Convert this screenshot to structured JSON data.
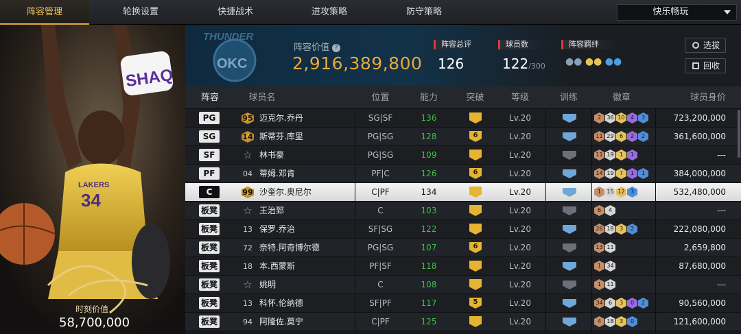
{
  "tabs": [
    "阵容管理",
    "轮换设置",
    "快捷战术",
    "进攻策略",
    "防守策略"
  ],
  "mode_select": {
    "value": "快乐畅玩"
  },
  "player_card": {
    "logo_text": "SHAQ",
    "jersey_number": "34",
    "team_text": "LAKERS",
    "market_value_label": "时刻价值",
    "market_value": "58,700,000"
  },
  "lineup_info": {
    "team_logo_text": "OKC",
    "team_logo_top_text": "THUNDER",
    "value_label": "阵容价值",
    "value": "2,916,389,800",
    "rating_label": "阵容总评",
    "rating": "126",
    "players_label": "球员数",
    "players": "122",
    "players_max": "/300",
    "chemistry_label": "阵容羁绊"
  },
  "buttons": {
    "scout": "选拔",
    "recycle": "回收"
  },
  "columns": [
    "阵容",
    "球员名",
    "位置",
    "能力",
    "突破",
    "等级",
    "训练",
    "徽章",
    "球员身价"
  ],
  "rows": [
    {
      "slot": "PG",
      "num": "95",
      "num_style": "gold",
      "name": "迈克尔.乔丹",
      "pos": "SG|SF",
      "ability": "136",
      "breakthrough": "",
      "level": "Lv.20",
      "train_color": "#6fa7d9",
      "badges": [
        [
          "2",
          "b-br"
        ],
        [
          "36",
          "b-si"
        ],
        [
          "10",
          "b-go"
        ],
        [
          "4",
          "b-pu"
        ],
        [
          "3",
          "b-bl"
        ]
      ],
      "value": "723,200,000"
    },
    {
      "slot": "SG",
      "num": "14",
      "num_style": "gold",
      "name": "斯蒂芬.库里",
      "pos": "PG|SG",
      "ability": "128",
      "breakthrough": "6",
      "level": "Lv.20",
      "train_color": "#6fa7d9",
      "badges": [
        [
          "11",
          "b-br"
        ],
        [
          "29",
          "b-si"
        ],
        [
          "6",
          "b-go"
        ],
        [
          "2",
          "b-pu"
        ],
        [
          "2",
          "b-bl"
        ]
      ],
      "value": "361,600,000"
    },
    {
      "slot": "SF",
      "num": "☆",
      "num_style": "star",
      "name": "林书豪",
      "pos": "PG|SG",
      "ability": "109",
      "breakthrough": "",
      "level": "Lv.20",
      "train_color": "#6c7078",
      "badges": [
        [
          "11",
          "b-br"
        ],
        [
          "19",
          "b-si"
        ],
        [
          "1",
          "b-go"
        ],
        [
          "1",
          "b-pu"
        ]
      ],
      "value": "---"
    },
    {
      "slot": "PF",
      "num": "04",
      "num_style": "",
      "name": "蒂姆.邓肯",
      "pos": "PF|C",
      "ability": "126",
      "breakthrough": "6",
      "level": "Lv.20",
      "train_color": "#6fa7d9",
      "badges": [
        [
          "14",
          "b-br"
        ],
        [
          "19",
          "b-si"
        ],
        [
          "7",
          "b-go"
        ],
        [
          "1",
          "b-pu"
        ],
        [
          "1",
          "b-bl"
        ]
      ],
      "value": "384,000,000"
    },
    {
      "slot": "C",
      "num": "99",
      "num_style": "gold",
      "name": "沙奎尔.奥尼尔",
      "pos": "C|PF",
      "ability": "134",
      "breakthrough": "",
      "level": "Lv.20",
      "train_color": "#6fa7d9",
      "badges": [
        [
          "1",
          "b-br"
        ],
        [
          "15",
          "b-si"
        ],
        [
          "12",
          "b-go"
        ],
        [
          "3",
          "b-bl"
        ]
      ],
      "value": "532,480,000",
      "selected": true
    },
    {
      "slot": "板凳",
      "num": "☆",
      "num_style": "star",
      "name": "王治郅",
      "pos": "C",
      "ability": "103",
      "breakthrough": "",
      "level": "Lv.20",
      "train_color": "#6c7078",
      "badges": [
        [
          "6",
          "b-br"
        ],
        [
          "4",
          "b-si"
        ]
      ],
      "value": "---"
    },
    {
      "slot": "板凳",
      "num": "13",
      "num_style": "",
      "name": "保罗.乔治",
      "pos": "SF|SG",
      "ability": "122",
      "breakthrough": "",
      "level": "Lv.20",
      "train_color": "#6fa7d9",
      "badges": [
        [
          "26",
          "b-br"
        ],
        [
          "18",
          "b-si"
        ],
        [
          "3",
          "b-go"
        ],
        [
          "2",
          "b-bl"
        ]
      ],
      "value": "222,080,000"
    },
    {
      "slot": "板凳",
      "num": "72",
      "num_style": "",
      "name": "奈特.阿奇博尔德",
      "pos": "PG|SG",
      "ability": "107",
      "breakthrough": "6",
      "level": "Lv.20",
      "train_color": "#6c7078",
      "badges": [
        [
          "13",
          "b-br"
        ],
        [
          "11",
          "b-si"
        ]
      ],
      "value": "2,659,800"
    },
    {
      "slot": "板凳",
      "num": "18",
      "num_style": "",
      "name": "本.西蒙斯",
      "pos": "PF|SF",
      "ability": "118",
      "breakthrough": "",
      "level": "Lv.20",
      "train_color": "#6fa7d9",
      "badges": [
        [
          "1",
          "b-br"
        ],
        [
          "34",
          "b-si"
        ]
      ],
      "value": "87,680,000"
    },
    {
      "slot": "板凳",
      "num": "☆",
      "num_style": "star",
      "name": "姚明",
      "pos": "C",
      "ability": "108",
      "breakthrough": "",
      "level": "Lv.20",
      "train_color": "#6c7078",
      "badges": [
        [
          "1",
          "b-br"
        ],
        [
          "11",
          "b-si"
        ]
      ],
      "value": "---"
    },
    {
      "slot": "板凳",
      "num": "13",
      "num_style": "",
      "name": "科怀.伦纳德",
      "pos": "SF|PF",
      "ability": "117",
      "breakthrough": "5",
      "level": "Lv.20",
      "train_color": "#6fa7d9",
      "badges": [
        [
          "34",
          "b-br"
        ],
        [
          "6",
          "b-si"
        ],
        [
          "3",
          "b-go"
        ],
        [
          "0",
          "b-pu"
        ],
        [
          "2",
          "b-bl"
        ]
      ],
      "value": "90,560,000"
    },
    {
      "slot": "板凳",
      "num": "94",
      "num_style": "",
      "name": "阿隆佐.莫宁",
      "pos": "C|PF",
      "ability": "125",
      "breakthrough": "",
      "level": "Lv.20",
      "train_color": "#6fa7d9",
      "badges": [
        [
          "4",
          "b-br"
        ],
        [
          "18",
          "b-si"
        ],
        [
          "3",
          "b-go"
        ],
        [
          "0",
          "b-bl"
        ]
      ],
      "value": "121,600,000"
    }
  ]
}
